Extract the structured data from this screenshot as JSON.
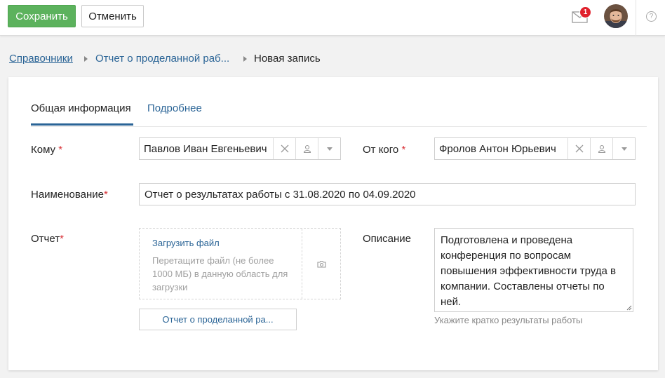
{
  "toolbar": {
    "save_label": "Сохранить",
    "cancel_label": "Отменить",
    "notification_count": "1",
    "help_label": "?"
  },
  "breadcrumb": {
    "item1": "Справочники",
    "item2": "Отчет о проделанной раб...",
    "current": "Новая запись"
  },
  "tabs": [
    {
      "label": "Общая информация",
      "active": true
    },
    {
      "label": "Подробнее",
      "active": false
    }
  ],
  "form": {
    "to_label": "Кому",
    "to_value": "Павлов Иван Евгеньевич",
    "from_label": "От кого",
    "from_value": "Фролов Антон Юрьевич",
    "name_label": "Наименование",
    "name_value": "Отчет о результатах работы с 31.08.2020 по 04.09.2020",
    "report_label": "Отчет",
    "upload_link": "Загрузить файл",
    "upload_hint": "Перетащите файл (не более 1000 МБ) в данную область для загрузки",
    "file_name": "Отчет о проделанной ра...",
    "description_label": "Описание",
    "description_value": "Подготовлена и проведена конференция по вопросам повышения эффективности труда в компании. Составлены отчеты по ней.",
    "description_hint": "Укажите кратко результаты работы",
    "required_mark": "*"
  },
  "colors": {
    "save": "#5cb25d",
    "link": "#2a6496",
    "required": "#d9353b",
    "badge": "#e0202b"
  },
  "icons": [
    "mail-icon",
    "clear-icon",
    "user-icon",
    "chevron-down-icon",
    "camera-icon",
    "help-icon",
    "resize-handle-icon"
  ]
}
